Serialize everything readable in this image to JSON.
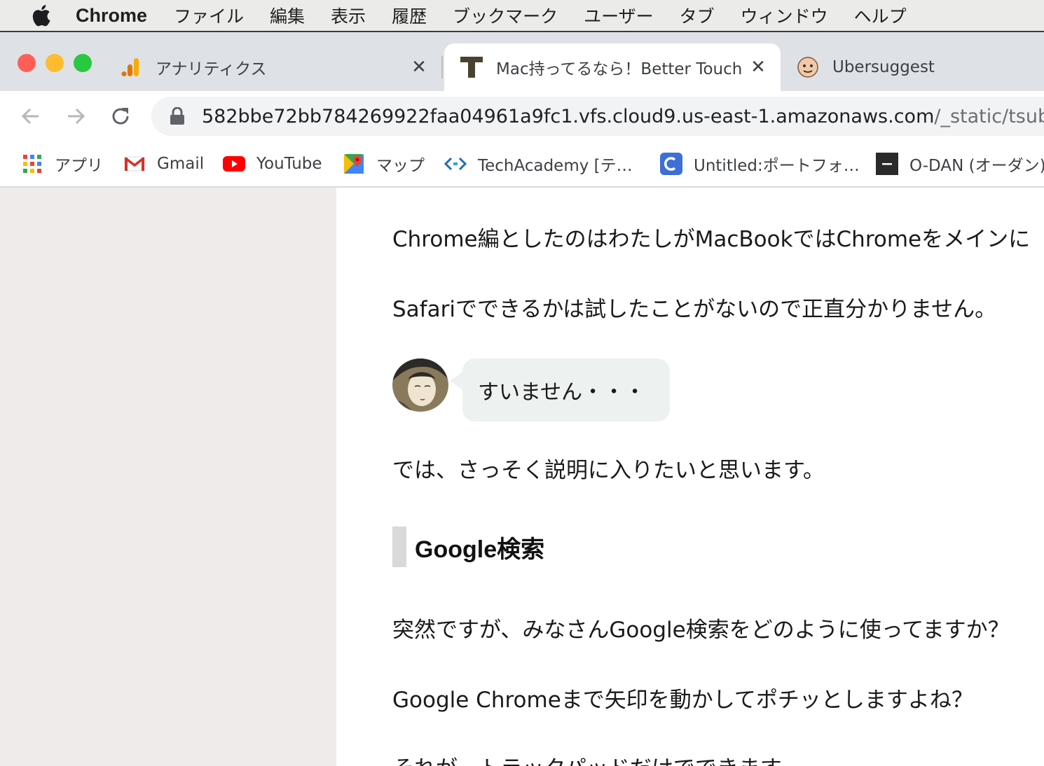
{
  "menubar": {
    "app_name": "Chrome",
    "items": [
      "ファイル",
      "編集",
      "表示",
      "履歴",
      "ブックマーク",
      "ユーザー",
      "タブ",
      "ウィンドウ",
      "ヘルプ"
    ]
  },
  "tabs": [
    {
      "title": "アナリティクス",
      "icon": "analytics-icon",
      "active": false
    },
    {
      "title": "Mac持ってるなら！Better Touch T",
      "icon": "t-logo-icon",
      "active": true
    },
    {
      "title": "Ubersuggest",
      "icon": "ubersuggest-face-icon",
      "active": false
    }
  ],
  "toolbar": {
    "url_host": "582bbe72bb784269922faa04961a9fc1.vfs.cloud9.us-east-1.amazonaws.com",
    "url_path": "/_static/tsubasa/bt"
  },
  "bookmarks": [
    {
      "label": "アプリ",
      "icon": "apps-grid-icon"
    },
    {
      "label": "Gmail",
      "icon": "gmail-icon"
    },
    {
      "label": "YouTube",
      "icon": "youtube-icon"
    },
    {
      "label": "マップ",
      "icon": "maps-icon"
    },
    {
      "label": "TechAcademy [テ…",
      "icon": "techacademy-icon"
    },
    {
      "label": "Untitled:ポートフォ…",
      "icon": "untitled-icon"
    },
    {
      "label": "O-DAN (オーダン)",
      "icon": "odan-icon"
    }
  ],
  "article": {
    "p1": "Chrome編としたのはわたしがMacBookではChromeをメインに",
    "p2": "Safariでできるかは試したことがないので正直分かりません。",
    "speech": "すいません・・・",
    "p3": "では、さっそく説明に入りたいと思います。",
    "heading": "Google検索",
    "p4": "突然ですが、みなさんGoogle検索をどのように使ってますか？",
    "p5": "Google Chromeまで矢印を動かしてポチッとしますよね？",
    "p6": "それが、トラックパッドだけでできます。"
  },
  "colors": {
    "sidebar": "#eeebea",
    "tabstrip": "#dee1e6",
    "bubble": "#edf1ef",
    "close_red": "#ff5f57",
    "minimize_yellow": "#febc2e",
    "zoom_green": "#28c840"
  }
}
